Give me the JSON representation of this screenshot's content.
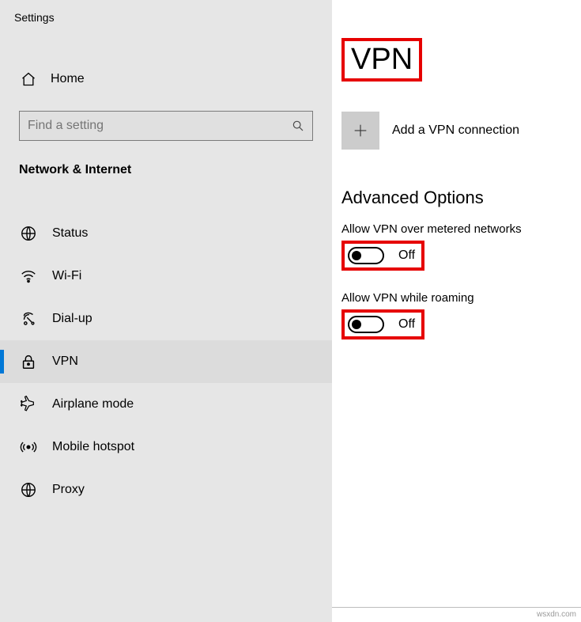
{
  "appTitle": "Settings",
  "home": {
    "label": "Home"
  },
  "search": {
    "placeholder": "Find a setting"
  },
  "sectionHeader": "Network & Internet",
  "nav": [
    {
      "key": "status",
      "label": "Status"
    },
    {
      "key": "wifi",
      "label": "Wi-Fi"
    },
    {
      "key": "dialup",
      "label": "Dial-up"
    },
    {
      "key": "vpn",
      "label": "VPN",
      "selected": true
    },
    {
      "key": "airplane",
      "label": "Airplane mode"
    },
    {
      "key": "hotspot",
      "label": "Mobile hotspot"
    },
    {
      "key": "proxy",
      "label": "Proxy"
    }
  ],
  "page": {
    "title": "VPN",
    "addLabel": "Add a VPN connection",
    "advancedHeader": "Advanced Options",
    "options": [
      {
        "label": "Allow VPN over metered networks",
        "stateText": "Off",
        "on": false
      },
      {
        "label": "Allow VPN while roaming",
        "stateText": "Off",
        "on": false
      }
    ]
  },
  "watermark": "wsxdn.com"
}
